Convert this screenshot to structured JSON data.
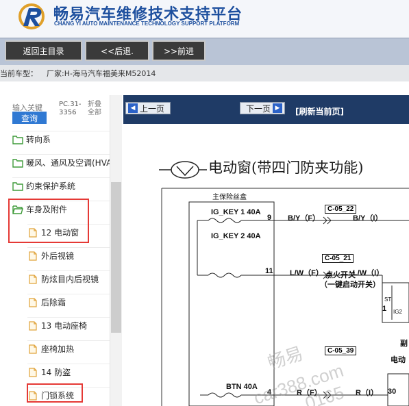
{
  "header": {
    "title": "畅易汽车维修技术支持平台",
    "subtitle": "CHANG YI AUTO MAINTENANCE TECHNOLOGY SUPPORT PLATFORM"
  },
  "toolbar": {
    "back_main": "返回主目录",
    "back": "<<后退.",
    "forward": ">>前进"
  },
  "car": {
    "label": "当前车型：",
    "value": "厂家:H-海马汽车福美来M52014"
  },
  "sidebar": {
    "search_placeholder": "输入关键",
    "search_button": "查询",
    "pc_code": "PC.31-3356",
    "collapse_all": "折叠全部",
    "items": [
      {
        "label": "转向系",
        "type": "folder"
      },
      {
        "label": "暖风、通风及空调(HVAC)",
        "type": "folder"
      },
      {
        "label": "约束保护系统",
        "type": "folder"
      },
      {
        "label": "车身及附件",
        "type": "folder-open"
      },
      {
        "label": "12 电动窗",
        "type": "doc"
      },
      {
        "label": "外后视镜",
        "type": "doc"
      },
      {
        "label": "防炫目内后视镜",
        "type": "doc"
      },
      {
        "label": "后除霜",
        "type": "doc"
      },
      {
        "label": "13 电动座椅",
        "type": "doc"
      },
      {
        "label": "座椅加热",
        "type": "doc"
      },
      {
        "label": "14 防盗",
        "type": "doc"
      },
      {
        "label": "门锁系统",
        "type": "doc"
      }
    ]
  },
  "pager": {
    "prev": "上一页",
    "next": "下一页",
    "refresh": "[刷新当前页]"
  },
  "diagram": {
    "title": "电动窗(带四门防夹功能)",
    "fuse_box": "主保险丝盒",
    "fuse1": "IG_KEY 1 40A",
    "fuse2": "IG_KEY 2 40A",
    "fuse3": "BTN 40A",
    "pin1": "9",
    "pin2": "11",
    "pin3": "4",
    "pin4": "30",
    "pin5": "1",
    "wire1": "B/Y（F）",
    "wire1b": "B/Y（I）",
    "wire2": "L/W（F）",
    "wire2b": "L/W（I）",
    "wire3": "R（F）",
    "wire3b": "R（I）",
    "conn1": "C-05_22",
    "conn2": "C-05_21",
    "conn3": "C-05_39",
    "ignition": "点火开关",
    "ignition_sub": "（一键启动开关）",
    "st_label": "ST",
    "ig2_label": "IG2",
    "right_label": "副",
    "right_label2": "电动",
    "watermark1": "畅易",
    "watermark2": "car388.com",
    "watermark3": "0165"
  },
  "colors": {
    "brand": "#1d4f9e",
    "highlight": "#e53935",
    "pager_bg": "#1f3b66",
    "search_button": "#3079d3"
  }
}
